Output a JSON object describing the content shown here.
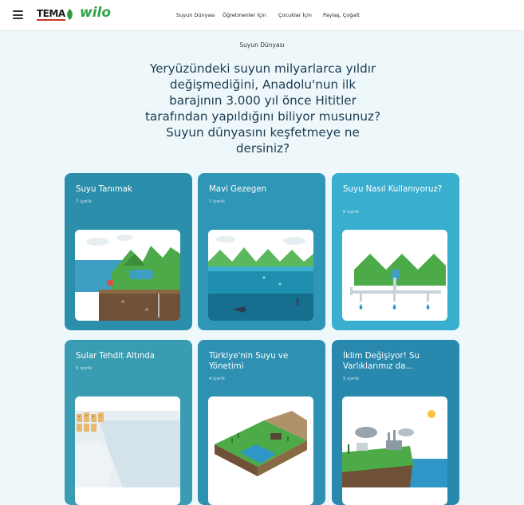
{
  "header": {
    "brand_tema": "TEMA",
    "brand_wilo": "wilo",
    "nav": [
      "Suyun Dünyası",
      "Öğretmenler İçin",
      "Çocuklar İçin",
      "Paylaş, Çoğalt"
    ]
  },
  "hero": {
    "eyebrow": "Suyun Dünyası",
    "headline": "Yeryüzündeki suyun milyarlarca yıldır değişmediğini, Anadolu'nun ilk barajının 3.000 yıl önce Hititler tarafından yapıldığını biliyor musunuz? Suyun dünyasını keşfetmeye ne dersiniz?"
  },
  "cards": [
    {
      "title": "Suyu Tanımak",
      "count": "7 içerik",
      "color": "#2b8eab",
      "illustration": "water-cycle-illustration"
    },
    {
      "title": "Mavi Gezegen",
      "count": "7 içerik",
      "color": "#2f96b7",
      "illustration": "blue-planet-illustration"
    },
    {
      "title": "Suyu Nasıl Kullanıyoruz?",
      "count": "6 içerik",
      "color": "#3aaecf",
      "illustration": "water-usage-illustration"
    },
    {
      "title": "Sular Tehdit Altında",
      "count": "5 içerik",
      "color": "#3a9cb2",
      "illustration": "threatened-water-illustration"
    },
    {
      "title": "Türkiye'nin Suyu ve Yönetimi",
      "count": "4 içerik",
      "color": "#2e91b2",
      "illustration": "turkey-water-management-illustration"
    },
    {
      "title": "İklim Değişiyor! Su Varlıklarımız da...",
      "count": "5 içerik",
      "color": "#2888ad",
      "illustration": "climate-change-illustration"
    }
  ]
}
